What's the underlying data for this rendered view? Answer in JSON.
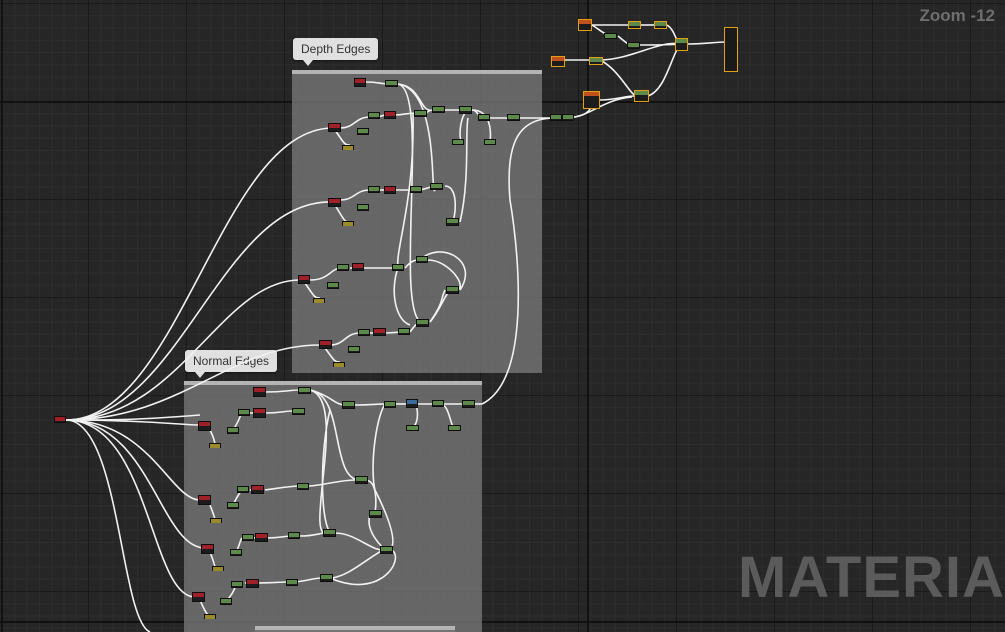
{
  "editor": {
    "zoom_label": "Zoom -12",
    "watermark": "MATERIAL"
  },
  "comments": [
    {
      "id": "depth",
      "title": "Depth Edges"
    },
    {
      "id": "normal",
      "title": "Normal Edges"
    }
  ],
  "colors": {
    "background": "#262626",
    "comment_box": "#787878",
    "wire": "#ffffff",
    "node_header_green": "#5d8a4a",
    "node_header_red": "#a0202a",
    "node_header_olive": "#9a8a2a",
    "selection_outline": "#e0a010"
  }
}
